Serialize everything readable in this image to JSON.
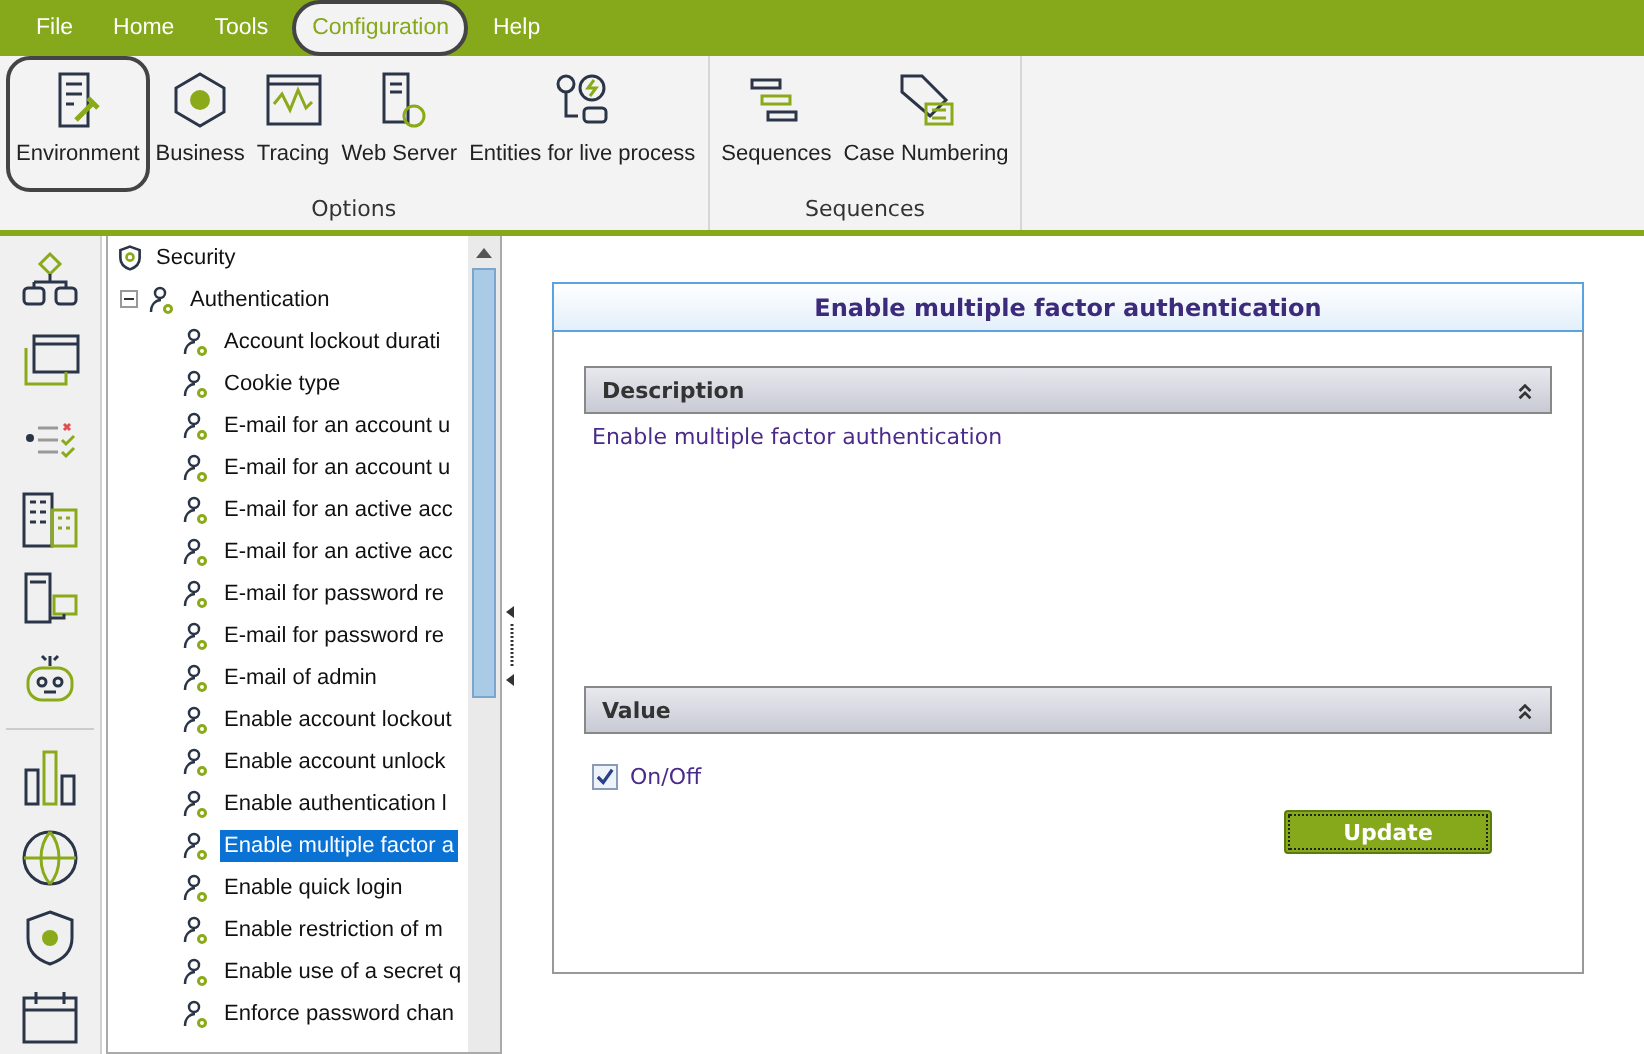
{
  "menu": [
    {
      "label": "File",
      "selected": false,
      "circled": false
    },
    {
      "label": "Home",
      "selected": false,
      "circled": false
    },
    {
      "label": "Tools",
      "selected": false,
      "circled": false
    },
    {
      "label": "Configuration",
      "selected": true,
      "circled": true
    },
    {
      "label": "Help",
      "selected": false,
      "circled": false
    }
  ],
  "ribbon": {
    "groups": [
      {
        "label": "Options",
        "items": [
          {
            "label": "Environment",
            "circled": true
          },
          {
            "label": "Business",
            "circled": false
          },
          {
            "label": "Tracing",
            "circled": false
          },
          {
            "label": "Web Server",
            "circled": false
          },
          {
            "label": "Entities for live process",
            "circled": false
          }
        ]
      },
      {
        "label": "Sequences",
        "items": [
          {
            "label": "Sequences",
            "circled": false
          },
          {
            "label": "Case Numbering",
            "circled": false
          }
        ]
      }
    ]
  },
  "tree": {
    "items": [
      {
        "label": "Security",
        "kind": "category",
        "children": [
          {
            "label": "Authentication",
            "kind": "group",
            "expanded": true,
            "children": [
              {
                "label": "Account lockout durati",
                "selected": false
              },
              {
                "label": "Cookie type",
                "selected": false
              },
              {
                "label": "E-mail for an account u",
                "selected": false
              },
              {
                "label": "E-mail for an account u",
                "selected": false
              },
              {
                "label": "E-mail for an active acc",
                "selected": false
              },
              {
                "label": "E-mail for an active acc",
                "selected": false
              },
              {
                "label": "E-mail for password re",
                "selected": false
              },
              {
                "label": "E-mail for password re",
                "selected": false
              },
              {
                "label": "E-mail of admin",
                "selected": false
              },
              {
                "label": "Enable account lockout",
                "selected": false
              },
              {
                "label": "Enable account unlock",
                "selected": false
              },
              {
                "label": "Enable authentication l",
                "selected": false
              },
              {
                "label": "Enable multiple factor a",
                "selected": true
              },
              {
                "label": "Enable quick login",
                "selected": false
              },
              {
                "label": "Enable restriction of m",
                "selected": false
              },
              {
                "label": "Enable use of a secret q",
                "selected": false
              },
              {
                "label": "Enforce password chan",
                "selected": false
              }
            ]
          }
        ]
      }
    ]
  },
  "panel": {
    "title": "Enable multiple factor authentication",
    "sections": [
      {
        "kind": "description",
        "title": "Description",
        "expanded": true,
        "text": "Enable multiple factor authentication"
      },
      {
        "kind": "value",
        "title": "Value",
        "expanded": true,
        "checkbox": {
          "label": "On/Off",
          "checked": true
        },
        "button": "Update"
      }
    ]
  }
}
